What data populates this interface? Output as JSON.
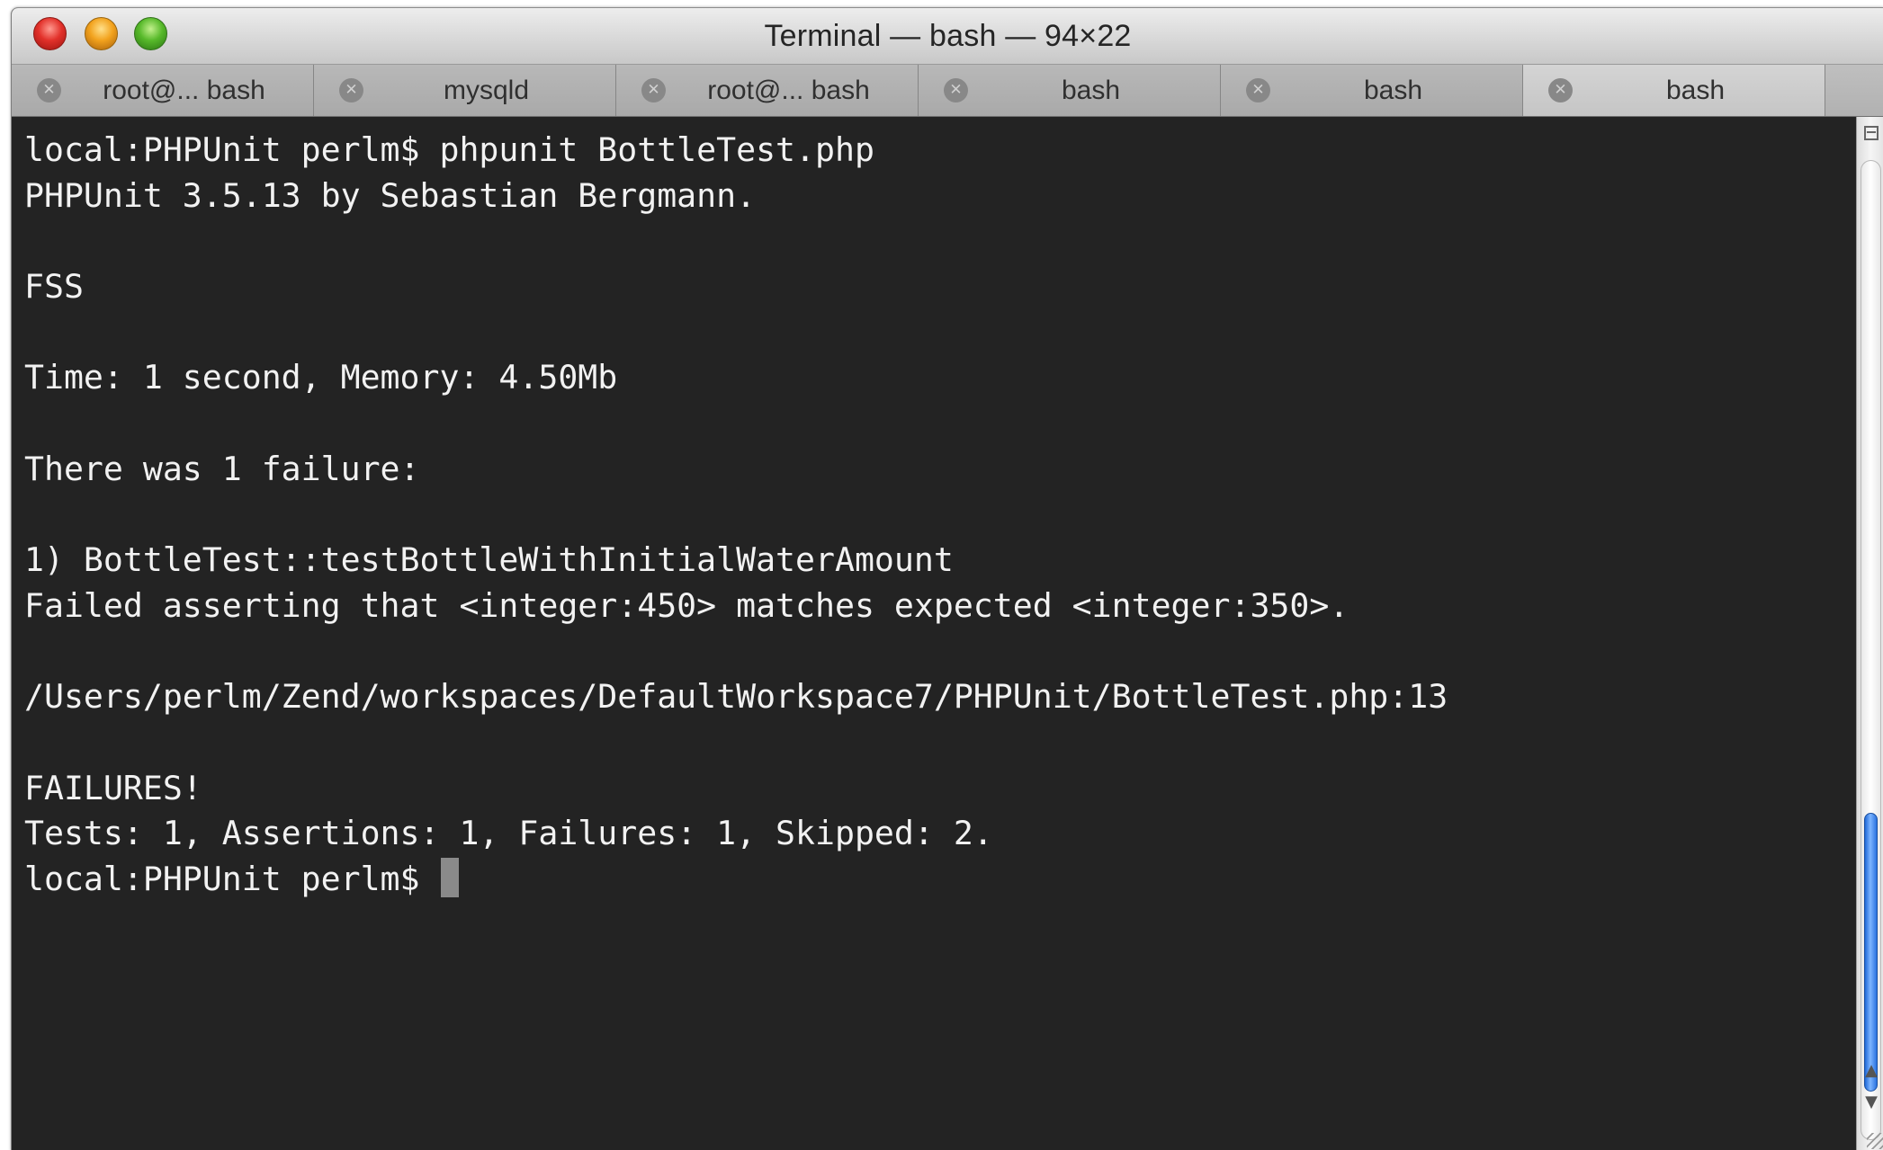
{
  "window": {
    "title": "Terminal — bash — 94×22"
  },
  "traffic_lights": {
    "close_icon": "close-icon",
    "minimize_icon": "minimize-icon",
    "zoom_icon": "zoom-icon"
  },
  "tabs": [
    {
      "label": "root@... bash",
      "close_symbol": "✕"
    },
    {
      "label": "mysqld",
      "close_symbol": "✕"
    },
    {
      "label": "root@... bash",
      "close_symbol": "✕"
    },
    {
      "label": "bash",
      "close_symbol": "✕"
    },
    {
      "label": "bash",
      "close_symbol": "✕"
    },
    {
      "label": "bash",
      "close_symbol": "✕"
    }
  ],
  "terminal": {
    "lines": [
      "local:PHPUnit perlm$ phpunit BottleTest.php",
      "PHPUnit 3.5.13 by Sebastian Bergmann.",
      "",
      "FSS",
      "",
      "Time: 1 second, Memory: 4.50Mb",
      "",
      "There was 1 failure:",
      "",
      "1) BottleTest::testBottleWithInitialWaterAmount",
      "Failed asserting that <integer:450> matches expected <integer:350>.",
      "",
      "/Users/perlm/Zend/workspaces/DefaultWorkspace7/PHPUnit/BottleTest.php:13",
      "",
      "FAILURES!",
      "Tests: 1, Assertions: 1, Failures: 1, Skipped: 2."
    ],
    "prompt": "local:PHPUnit perlm$ "
  },
  "scrollbar": {
    "up_arrow": "▲",
    "down_arrow": "▼",
    "position": 0.72
  },
  "colors": {
    "terminal_background": "#232323",
    "terminal_text": "#f2f2f2",
    "scroll_thumb": "#2a72e0"
  }
}
